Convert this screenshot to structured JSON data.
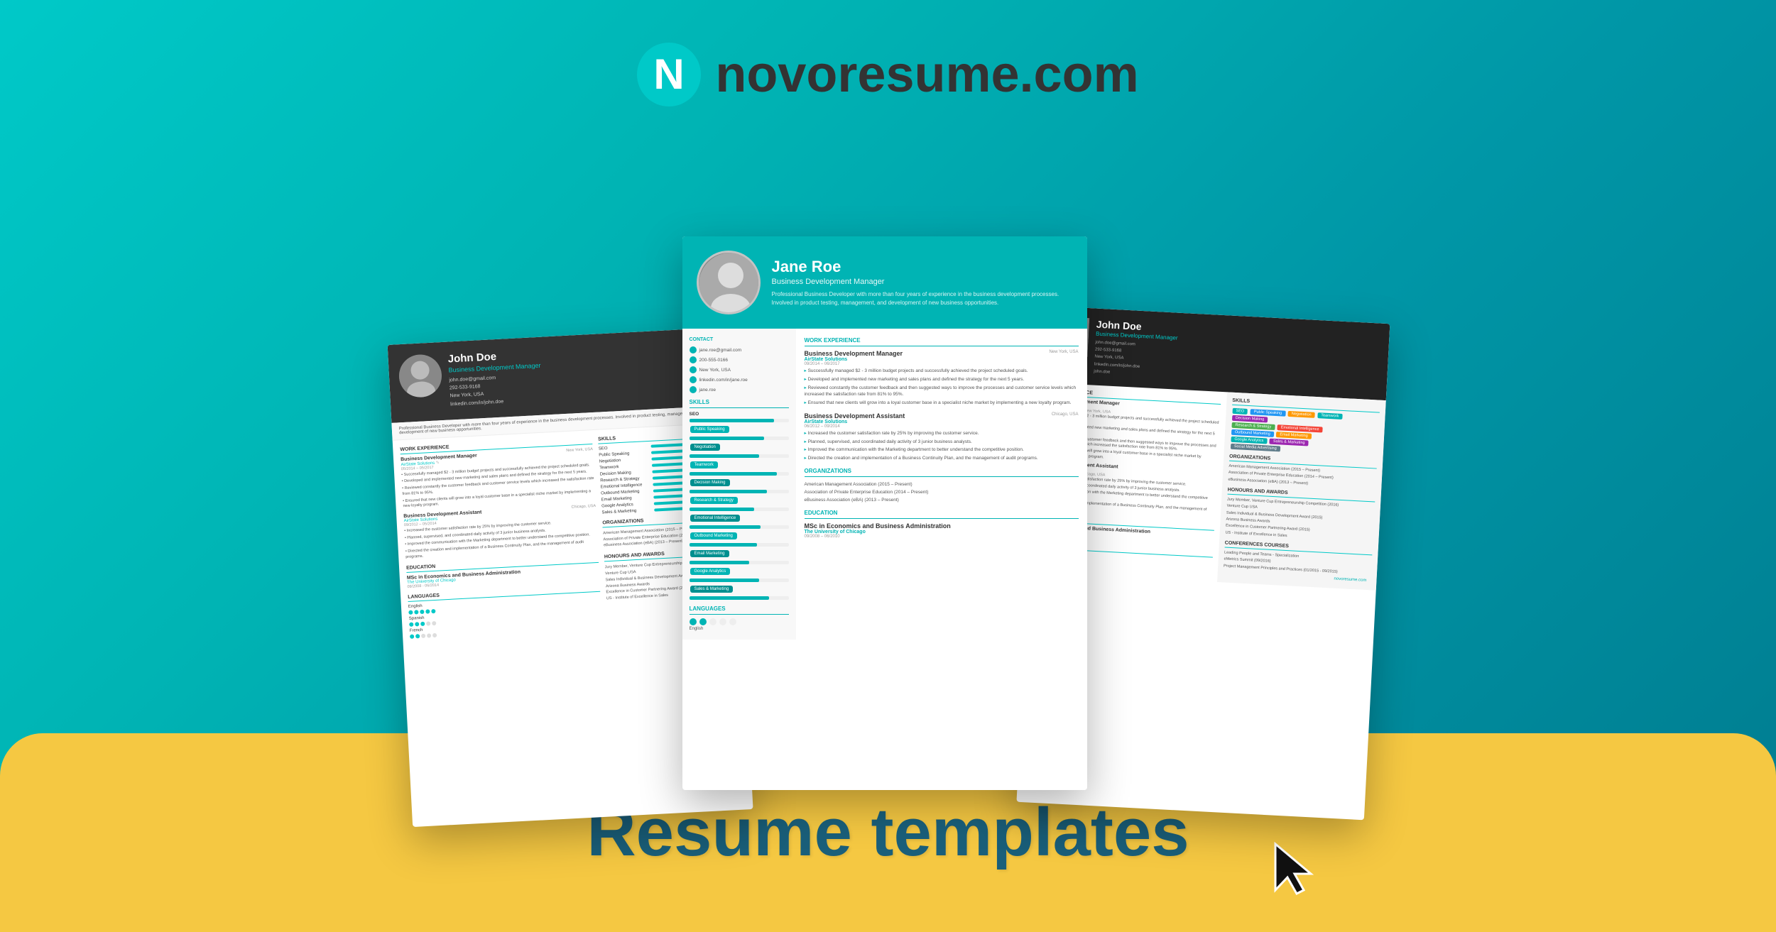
{
  "brand": {
    "logo_text": "novoresume.com",
    "logo_n_color": "#00b4b4",
    "tagline": "Resume templates"
  },
  "resumes": {
    "left": {
      "name": "John Doe",
      "title": "Business Development Manager",
      "email": "john.doe@gmail.com",
      "phone": "292-533-9168",
      "location": "New York, USA",
      "linkedin": "linkedin.com/in/john.doe",
      "sections": {
        "work_experience": "WORK EXPERIENCE",
        "skills": "SKILLS",
        "education": "EDUCATION",
        "languages": "LANGUAGES"
      },
      "jobs": [
        {
          "title": "Business Development Manager",
          "company": "AirState Solutions",
          "dates": "05/2014 - 05/2017",
          "location": "New York, USA"
        },
        {
          "title": "Business Development Assistant",
          "company": "AirState Solutions",
          "dates": "09/2012 - 05/2014",
          "location": "Chicago, USA"
        }
      ],
      "skills": [
        "SEO",
        "Public Speaking",
        "Negotiation",
        "Teamwork",
        "Decision Making",
        "Research & Strategy",
        "Emotional Intelligence",
        "Outbound Marketing",
        "Email Marketing",
        "Google Analytics",
        "Sales & Marketing"
      ],
      "education": {
        "degree": "MSc in Economics and Business Administration",
        "school": "The University of Chicago",
        "dates": "09/2008 - 06/2014"
      },
      "languages": [
        "English",
        "Spanish",
        "French"
      ]
    },
    "center": {
      "name": "Jane Roe",
      "title": "Business Development Manager",
      "email": "jane.roe@gmail.com",
      "phone": "200-555-0166",
      "location": "New York, USA",
      "linkedin": "linkedin.com/in/jane.roe",
      "github": "jane.roe",
      "summary": "Professional Business Developer with more than four years of experience in the business development processes. Involved in product testing, management, and development of new business opportunities.",
      "work_section": "WORK EXPERIENCE",
      "jobs": [
        {
          "title": "Business Development Manager",
          "company": "AirState Solutions",
          "dates": "09/2014 - 06/2017",
          "location": "New York, USA",
          "bullets": [
            "Successfully managed $2 - 3 million budget projects and successfully achieved the project scheduled goals.",
            "Developed and implemented new marketing and sales plans and defined the strategy for the next 5 years.",
            "Reviewed constantly the customer feedback and then suggested ways to improve the processes and customer service levels which increased the satisfaction rate from 81% to 95%.",
            "Ensured that new clients will grow into a loyal customer base in a specialist niche market by implementing a new loyalty program."
          ]
        },
        {
          "title": "Business Development Assistant",
          "company": "AirState Solutions",
          "dates": "06/2012 - 09/2014",
          "location": "Chicago, USA",
          "bullets": [
            "Increased the customer satisfaction rate by 25% by improving the customer service.",
            "Planned, supervised, and coordinated daily activity of 3 junior business analysts.",
            "Improved the communication with the Marketing department to better understand the competitive position.",
            "Directed the creation and implementation of a Business Continuity Plan, and the management of audit programs."
          ]
        }
      ],
      "organizations": {
        "title": "ORGANIZATIONS",
        "items": [
          "American Management Association (2015 - Present)",
          "Association of Private Enterprise Education (2014 - Present)",
          "eBusiness Association (eBA) (2013 - Present)"
        ]
      },
      "education": {
        "title": "EDUCATION",
        "degree": "MSc in Economics and Business Administration",
        "school": "The University of Chicago",
        "dates": "09/2008 - 06/2010"
      },
      "languages": {
        "title": "LANGUAGES",
        "items": [
          "English"
        ]
      },
      "skills": {
        "title": "SKILLS",
        "items": [
          "SEO",
          "Public Speaking",
          "Negotiation",
          "Teamwork",
          "Decision Making",
          "Research & Strategy",
          "Emotional Intelligence",
          "Outbound Marketing",
          "Email Marketing",
          "Google Analytics",
          "Sales & Marketing"
        ]
      }
    },
    "right": {
      "name": "John Doe",
      "title": "Business Development Manager",
      "email": "john.doe@gmail.com",
      "phone": "292-533-9168",
      "location": "New York, USA",
      "linkedin": "linkedin.com/in/john.doe",
      "github": "john.doe",
      "skills": {
        "title": "SKILLS",
        "tags": [
          "SEO",
          "Public Speaking",
          "Negotiation",
          "Teamwork",
          "Decision Making",
          "Research & Strategy",
          "Emotional Intelligence",
          "Outbound Marketing",
          "Email Marketing",
          "Google Analytics",
          "Sales & Marketing",
          "Social Media Advertising"
        ]
      },
      "organizations": {
        "title": "ORGANIZATIONS",
        "items": [
          "American Management Association (2015 - Present)",
          "Association of Private Enterprise Education (2014 - Present)",
          "eBusiness Association (eBA) (2013 - Present)"
        ]
      },
      "honours": {
        "title": "HONOURS AND AWARDS",
        "items": [
          "Jury Member, Venture Cup Entrepreneurship Competition (2016)",
          "Sales Individual & Business Development Award (2015)",
          "Excellence in Customer Partnering Award (2015)"
        ]
      },
      "conferences": {
        "title": "CONFERENCES COURSES",
        "items": [
          "Leading People and Teams - Specialization",
          "eMetrics Summit (09/2016)",
          "Project Management Principles and Practices (01/2015 - 09/2015)"
        ]
      },
      "brand": "novoresume.com"
    }
  },
  "banner": {
    "text": "Resume templates"
  }
}
